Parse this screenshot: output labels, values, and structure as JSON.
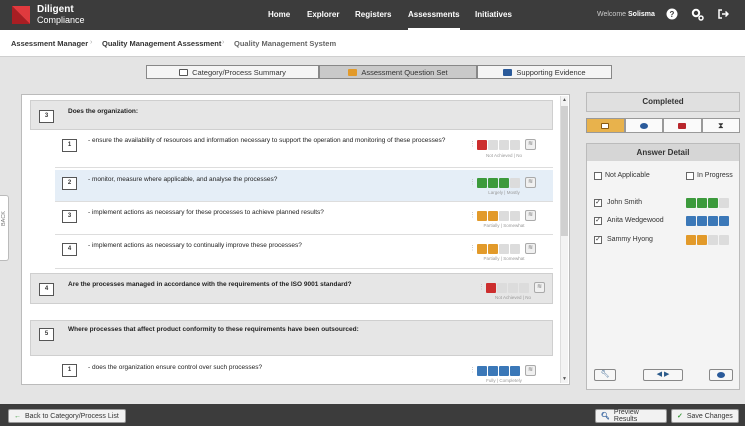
{
  "app": {
    "brand_line1": "Diligent",
    "brand_line2": "Compliance"
  },
  "nav": {
    "home": "Home",
    "explorer": "Explorer",
    "registers": "Registers",
    "assessments": "Assessments",
    "initiatives": "Initiatives"
  },
  "user": {
    "welcome": "Welcome",
    "name": "Solisma"
  },
  "breadcrumb": {
    "item1": "Assessment Manager",
    "item2": "Quality Management Assessment",
    "item3": "Quality Management System"
  },
  "tabs": {
    "summary": "Category/Process Summary",
    "question_set": "Assessment Question Set",
    "evidence": "Supporting Evidence"
  },
  "side_handle": {
    "label": "BACK"
  },
  "sections": [
    {
      "number": "3",
      "text": "Does the organization:"
    },
    {
      "number": "4",
      "text": "Are the processes managed in accordance with the requirements of the ISO 9001 standard?"
    },
    {
      "number": "5",
      "text": "Where processes that affect product conformity to these requirements have been outsourced:"
    }
  ],
  "questions": [
    {
      "number": "1",
      "text": "- ensure the availability of resources and information necessary to support the operation and monitoring of these processes?",
      "rating_label": "Not Achieved | No",
      "colors": [
        "red",
        "grey",
        "grey",
        "grey"
      ]
    },
    {
      "number": "2",
      "text": "- monitor, measure where applicable, and analyse the processes?",
      "rating_label": "Largely | Mostly",
      "colors": [
        "green",
        "green",
        "green",
        "grey"
      ]
    },
    {
      "number": "3",
      "text": "- implement actions as necessary for these processes to achieve planned results?",
      "rating_label": "Partially | Somewhat",
      "colors": [
        "orange",
        "orange",
        "grey",
        "grey"
      ]
    },
    {
      "number": "4",
      "text": "- implement actions as necessary to continually improve these processes?",
      "rating_label": "Partially | Somewhat",
      "colors": [
        "orange",
        "orange",
        "grey",
        "grey"
      ]
    },
    {
      "number": "1",
      "text": "- does the organization ensure control over such processes?",
      "rating_label": "Fully | Completely",
      "colors": [
        "blue",
        "blue",
        "blue",
        "blue"
      ]
    }
  ],
  "section4_rating": {
    "rating_label": "Not Achieved | No",
    "colors": [
      "red",
      "grey",
      "grey",
      "grey"
    ]
  },
  "status_panel": {
    "title": "Completed"
  },
  "answer_detail": {
    "title": "Answer Detail",
    "not_applicable": "Not Applicable",
    "in_progress": "In Progress",
    "respondents": [
      {
        "name": "John Smith",
        "checked": "✓",
        "colors": [
          "green",
          "green",
          "green",
          "grey"
        ]
      },
      {
        "name": "Anita Wedgewood",
        "checked": "✓",
        "colors": [
          "blue",
          "blue",
          "blue",
          "blue"
        ]
      },
      {
        "name": "Sammy Hyong",
        "checked": "✓",
        "colors": [
          "orange",
          "orange",
          "grey",
          "grey"
        ]
      }
    ]
  },
  "footer": {
    "back_button": "Back to Category/Process List",
    "preview_button": "Preview Results",
    "save_button": "Save Changes"
  },
  "colors": {
    "red": "#cc2e2e",
    "green": "#3c9a3c",
    "orange": "#e29a2a",
    "blue": "#3b78b8",
    "grey": "#dcdcdc",
    "brand_red": "#c8262c",
    "topbar": "#3c3c3c"
  }
}
